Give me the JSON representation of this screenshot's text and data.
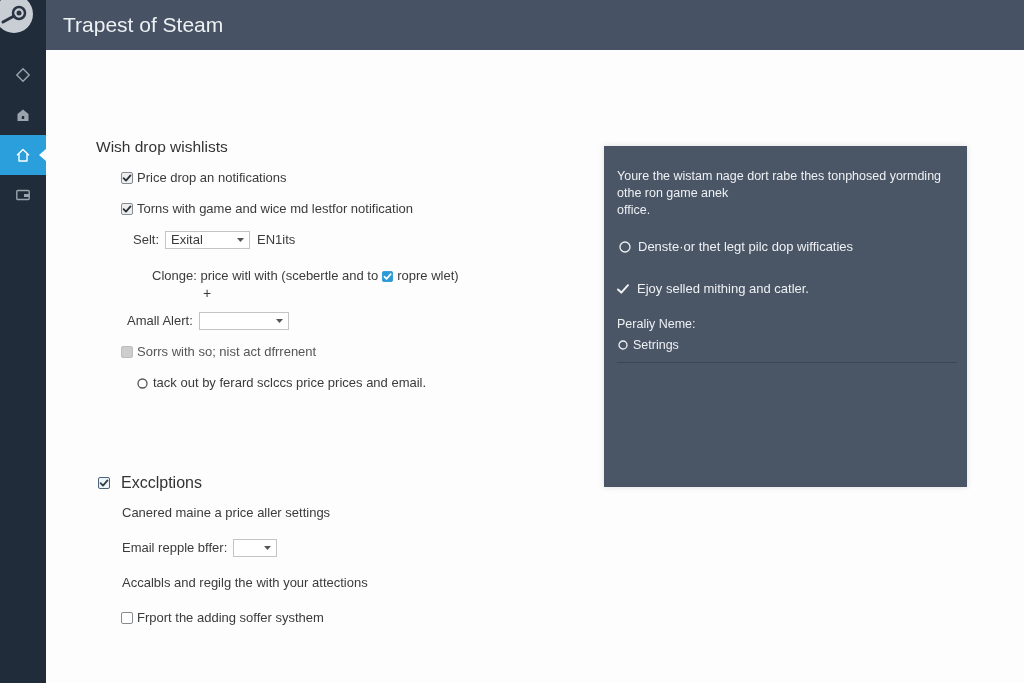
{
  "window": {
    "title": "Trapest of Steam"
  },
  "sidebar": {
    "items": [
      {
        "selected": false
      },
      {
        "selected": false
      },
      {
        "selected": true
      },
      {
        "selected": false
      }
    ]
  },
  "sections": [
    {
      "title": "Wish drop wishlists",
      "items": [
        {
          "kind": "checkbox",
          "label": "Price drop an notifications",
          "checked": true,
          "disabled": false
        },
        {
          "kind": "checkbox",
          "label": "Torns with game and wice md lestfor notification",
          "checked": true,
          "disabled": false
        },
        {
          "kind": "select",
          "label": "Selt:",
          "value": "Exital",
          "suffix": "EN1its"
        },
        {
          "kind": "note",
          "text_before": "Clonge: price witl with (scebertle and to",
          "checked": true,
          "text_after": "ropre wlet)",
          "mark_below": "+"
        },
        {
          "kind": "select",
          "label": "Amall Alert:"
        },
        {
          "kind": "checkbox",
          "label": "Sorrs with so; nist act dfrrenent",
          "checked": false,
          "disabled": true
        },
        {
          "kind": "radio",
          "label": "tack out by ferard sclccs price prices and email.",
          "selected": false
        }
      ]
    },
    {
      "title": "Excclptions",
      "checked": true,
      "items": [
        {
          "kind": "text",
          "text": "Canered maine a price aller settings"
        },
        {
          "kind": "select",
          "label": "Email repple bffer:"
        },
        {
          "kind": "text",
          "text": "Accalbls and regilg the with your attections"
        },
        {
          "kind": "checkbox",
          "label": "Frport the adding soffer systhem",
          "checked": false,
          "disabled": false
        }
      ]
    }
  ],
  "panel": {
    "text": "Youre the wistam nage dort rabe thes tonphosed yormding\nothe ron game anek\noffice.",
    "items": [
      {
        "kind": "radio",
        "label": "Denste·or thet legt pilc dop wifficaties",
        "selected": false
      },
      {
        "kind": "check",
        "label": "Ejoy selled mithing and catler.",
        "checked": true
      },
      {
        "kind": "label",
        "label": "Peraliy Neme:"
      },
      {
        "kind": "radio",
        "label": "Setrings",
        "selected": false
      }
    ]
  }
}
